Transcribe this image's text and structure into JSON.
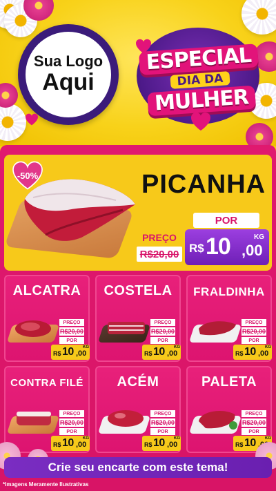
{
  "header": {
    "logo_line1": "Sua Logo",
    "logo_line2": "Aqui",
    "badge_line1": "ESPECIAL",
    "badge_line2": "DIA DA",
    "badge_line3": "MULHER"
  },
  "hero": {
    "product": "PICANHA",
    "discount": "-50%",
    "preco_label": "PREÇO",
    "old_price": "R$20,00",
    "por_label": "POR",
    "currency": "R$",
    "price_int": "10",
    "price_cents": ",00",
    "unit": "KG"
  },
  "cards": [
    {
      "name": "ALCATRA",
      "preco_label": "PREÇO",
      "old_price": "R$20,00",
      "por_label": "POR",
      "currency": "R$",
      "price_int": "10",
      "price_cents": ",00",
      "unit": "KG"
    },
    {
      "name": "COSTELA",
      "preco_label": "PREÇO",
      "old_price": "R$20,00",
      "por_label": "POR",
      "currency": "R$",
      "price_int": "10",
      "price_cents": ",00",
      "unit": "KG"
    },
    {
      "name": "FRALDINHA",
      "preco_label": "PREÇO",
      "old_price": "R$20,00",
      "por_label": "POR",
      "currency": "R$",
      "price_int": "10",
      "price_cents": ",00",
      "unit": "KG"
    },
    {
      "name": "CONTRA FILÉ",
      "preco_label": "PREÇO",
      "old_price": "R$20,00",
      "por_label": "POR",
      "currency": "R$",
      "price_int": "10",
      "price_cents": ",00",
      "unit": "KG"
    },
    {
      "name": "ACÉM",
      "preco_label": "PREÇO",
      "old_price": "R$20,00",
      "por_label": "POR",
      "currency": "R$",
      "price_int": "10",
      "price_cents": ",00",
      "unit": "KG"
    },
    {
      "name": "PALETA",
      "preco_label": "PREÇO",
      "old_price": "R$20,00",
      "por_label": "POR",
      "currency": "R$",
      "price_int": "10",
      "price_cents": ",00",
      "unit": "KG"
    }
  ],
  "footer": {
    "cta": "Crie seu encarte com este tema!",
    "disclaimer": "*Imagens Meramente Ilustrativas"
  },
  "colors": {
    "yellow": "#f7c91a",
    "pink": "#dd1470",
    "purple": "#6e1fb6",
    "dark_purple": "#3b1b7a"
  }
}
